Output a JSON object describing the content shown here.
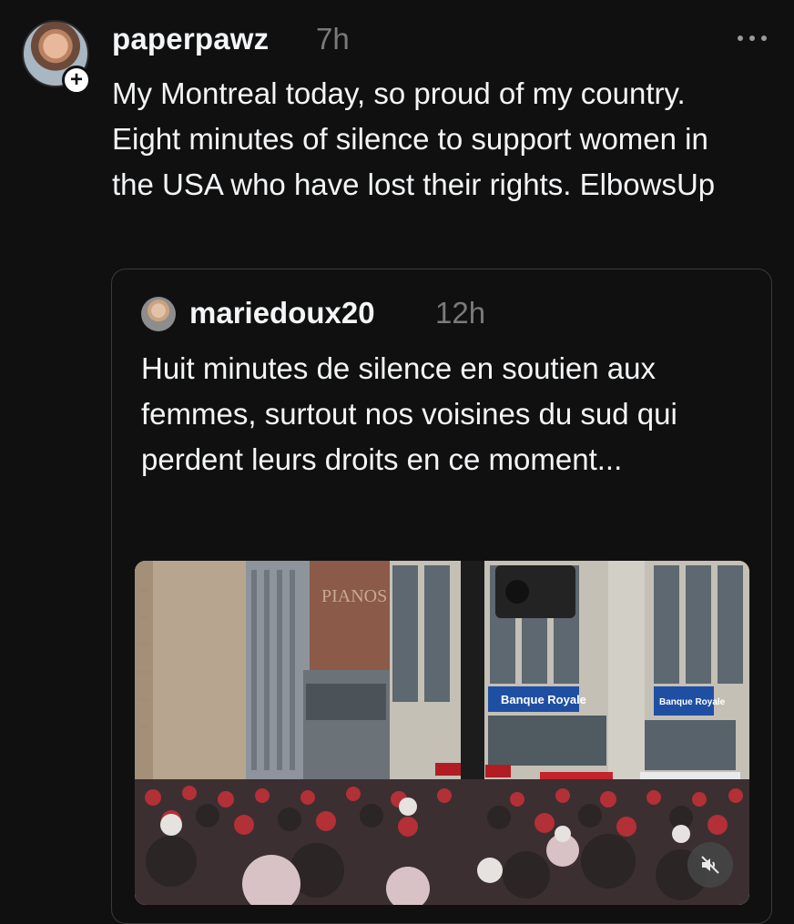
{
  "post": {
    "author": "paperpawz",
    "time": "7h",
    "text": "My Montreal today, so proud of my country. Eight minutes of silence to support women in the USA who have lost their rights. ElbowsUp",
    "more_icon": "more-horizontal-icon",
    "follow_icon": "plus-icon"
  },
  "quote": {
    "author": "mariedoux20",
    "time": "12h",
    "text": "Huit minutes de silence en soutien aux femmes, surtout nos voisines du sud qui perdent leurs droits en ce moment...",
    "media": {
      "description_icon": "video-thumbnail",
      "sign_left": "Banque Royale",
      "sign_right": "Banque Royale",
      "building_sign": "PIANOS",
      "mute_icon": "speaker-muted-icon"
    }
  },
  "colors": {
    "background": "#101010",
    "text_primary": "#f3f5f7",
    "text_secondary": "#7a7a7a",
    "card_border": "#3a3a3a",
    "bank_blue": "#1f4fa3"
  }
}
